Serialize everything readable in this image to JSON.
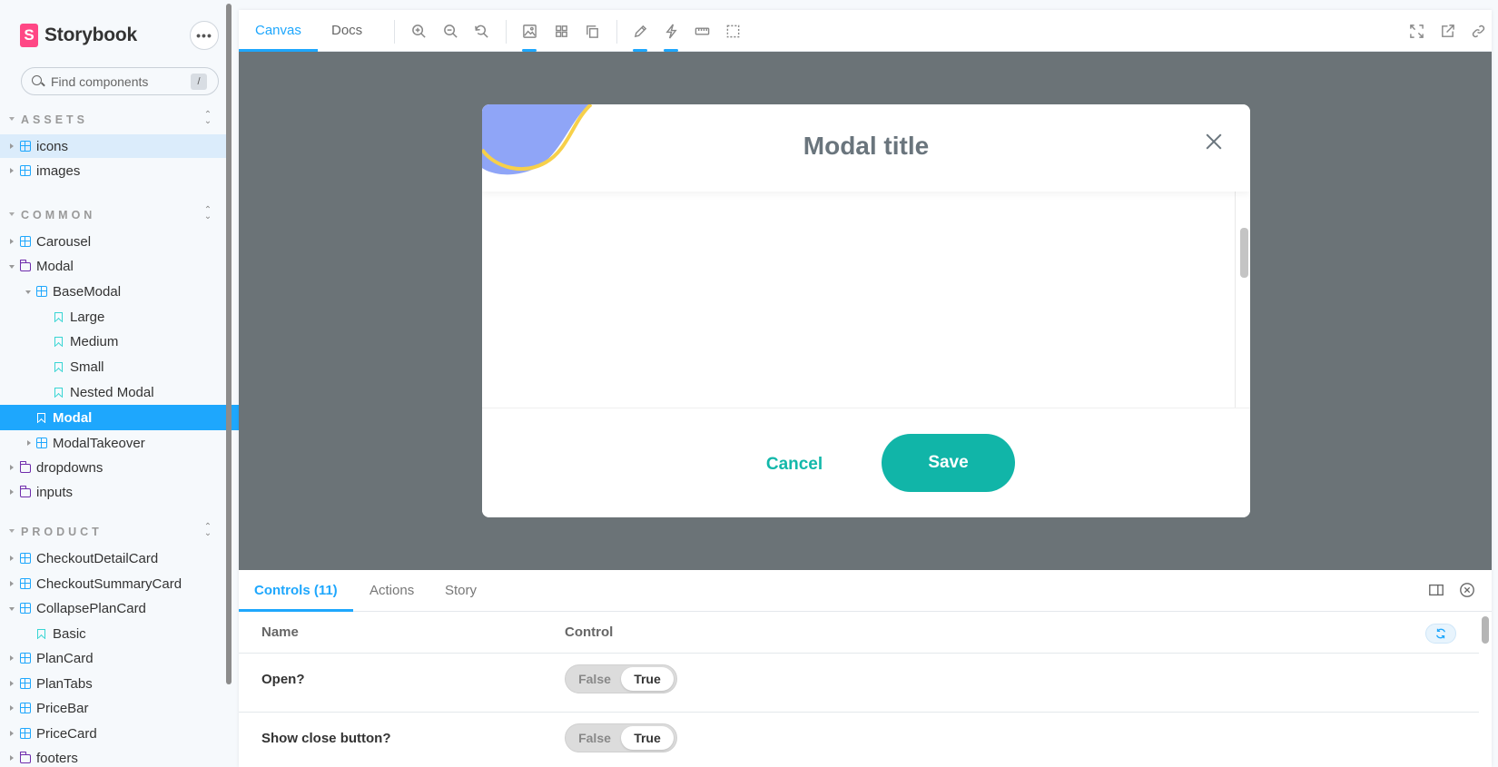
{
  "brand": {
    "name": "Storybook",
    "logo_letter": "S"
  },
  "search": {
    "placeholder": "Find components",
    "shortcut": "/"
  },
  "sections": [
    {
      "label": "ASSETS"
    },
    {
      "label": "COMMON"
    },
    {
      "label": "PRODUCT"
    }
  ],
  "tree": [
    {
      "label": "icons"
    },
    {
      "label": "images"
    },
    {
      "label": "Carousel"
    },
    {
      "label": "Modal"
    },
    {
      "label": "BaseModal"
    },
    {
      "label": "Large"
    },
    {
      "label": "Medium"
    },
    {
      "label": "Small"
    },
    {
      "label": "Nested Modal"
    },
    {
      "label": "Modal"
    },
    {
      "label": "ModalTakeover"
    },
    {
      "label": "dropdowns"
    },
    {
      "label": "inputs"
    },
    {
      "label": "CheckoutDetailCard"
    },
    {
      "label": "CheckoutSummaryCard"
    },
    {
      "label": "CollapsePlanCard"
    },
    {
      "label": "Basic"
    },
    {
      "label": "PlanCard"
    },
    {
      "label": "PlanTabs"
    },
    {
      "label": "PriceBar"
    },
    {
      "label": "PriceCard"
    },
    {
      "label": "footers"
    }
  ],
  "toolbar": {
    "tabs": [
      {
        "label": "Canvas"
      },
      {
        "label": "Docs"
      }
    ]
  },
  "modal": {
    "title": "Modal title",
    "cancel_label": "Cancel",
    "save_label": "Save"
  },
  "panel": {
    "tabs": [
      {
        "label": "Controls (11)"
      },
      {
        "label": "Actions"
      },
      {
        "label": "Story"
      }
    ],
    "headers": {
      "name": "Name",
      "control": "Control"
    },
    "rows": [
      {
        "name": "Open?",
        "false_label": "False",
        "true_label": "True",
        "value": true
      },
      {
        "name": "Show close button?",
        "false_label": "False",
        "true_label": "True",
        "value": true
      }
    ]
  },
  "colors": {
    "accent": "#1ea7fd",
    "brand": "#ff4785",
    "canvas_bg": "#6b7377",
    "modal_button": "#11b5a8",
    "modal_title": "#6a757d",
    "deco_blue": "#8fa5f7",
    "deco_yellow": "#f7d04a"
  }
}
